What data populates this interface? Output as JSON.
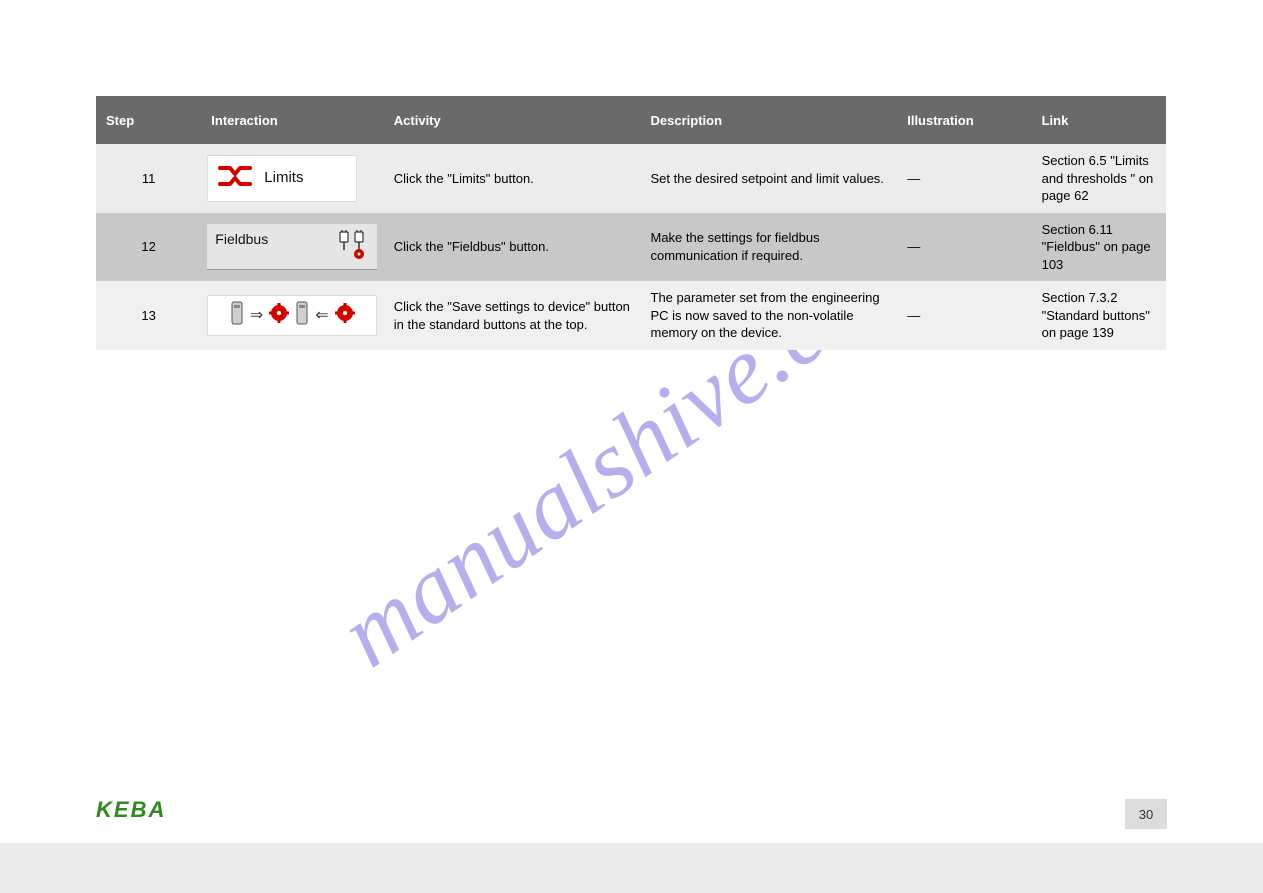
{
  "watermark": "manualshive.com",
  "header": {
    "step": "Step",
    "interaction": "Interaction",
    "activity": "Activity",
    "description": "Description",
    "illustration": "Illustration",
    "link": "Link"
  },
  "rows": [
    {
      "step": "11",
      "iconLabel": "Limits",
      "activity": "Click the \"Limits\" button.",
      "description": "Set the desired setpoint and limit values.",
      "illustration": "—",
      "link": "Section 6.5 \"Limits and thresholds \" on page 62"
    },
    {
      "step": "12",
      "iconLabel": "Fieldbus",
      "activity": "Click the \"Fieldbus\" button.",
      "description": "Make the settings for fieldbus communication if required.",
      "illustration": "—",
      "link": "Section 6.11 \"Fieldbus\" on page 103"
    },
    {
      "step": "13",
      "iconLabel": "",
      "activity": "Click the \"Save settings to device\" button in the standard buttons at the top.",
      "description": "The parameter set from the engineering PC is now saved to the non-volatile memory on the device.",
      "illustration": "—",
      "link": "Section 7.3.2 \"Standard buttons\" on page 139"
    }
  ],
  "logo": "KEBA",
  "pageNumber": "30",
  "icons": {
    "limits": "limits-icon",
    "fieldbus": "fieldbus-icon",
    "saveToDevice": "save-to-device-icon"
  }
}
